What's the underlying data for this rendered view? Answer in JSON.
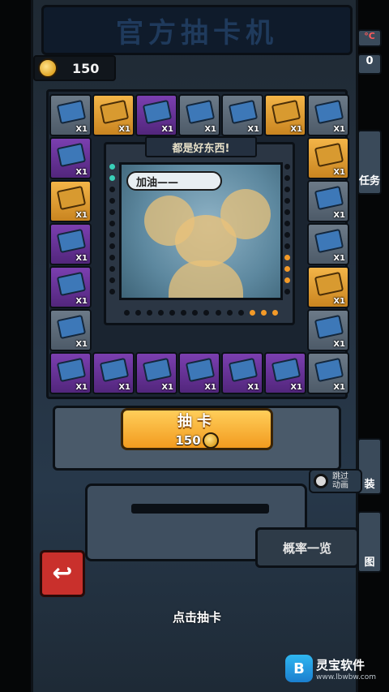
{
  "machine": {
    "title": "官方抽卡机",
    "coins": "150"
  },
  "board": {
    "top_row": [
      {
        "color": "gray",
        "qty": "X1"
      },
      {
        "color": "gold",
        "qty": "X1"
      },
      {
        "color": "purple",
        "qty": "X1"
      },
      {
        "color": "gray",
        "qty": "X1"
      },
      {
        "color": "gray",
        "qty": "X1"
      },
      {
        "color": "gold",
        "qty": "X1"
      },
      {
        "color": "gray",
        "qty": "X1"
      }
    ],
    "left_col": [
      {
        "color": "purple",
        "qty": "X1"
      },
      {
        "color": "gold",
        "qty": "X1"
      },
      {
        "color": "purple",
        "qty": "X1"
      },
      {
        "color": "purple",
        "qty": "X1"
      },
      {
        "color": "gray",
        "qty": "X1"
      }
    ],
    "right_col": [
      {
        "color": "gold",
        "qty": "X1"
      },
      {
        "color": "gray",
        "qty": "X1"
      },
      {
        "color": "gray",
        "qty": "X1"
      },
      {
        "color": "gold",
        "qty": "X1"
      },
      {
        "color": "gray",
        "qty": "X1"
      }
    ],
    "bottom_row": [
      {
        "color": "purple",
        "qty": "X1"
      },
      {
        "color": "purple",
        "qty": "X1"
      },
      {
        "color": "purple",
        "qty": "X1"
      },
      {
        "color": "purple",
        "qty": "X1"
      },
      {
        "color": "purple",
        "qty": "X1"
      },
      {
        "color": "purple",
        "qty": "X1"
      },
      {
        "color": "gray",
        "qty": "X1"
      }
    ]
  },
  "center": {
    "banner": "都是好东西!",
    "speech": "加油——"
  },
  "draw_button": {
    "label": "抽卡",
    "cost": "150"
  },
  "skip_toggle": {
    "label": "跳过动画"
  },
  "probability_button": {
    "label": "概率一览"
  },
  "footer": {
    "hint": "点击抽卡"
  },
  "side_peek": {
    "top_temp": "°C",
    "top_counter": "0",
    "task": "任务",
    "bag": "装",
    "map": "图"
  },
  "watermark": {
    "name": "灵宝软件",
    "url": "www.lbwbw.com",
    "logo_letter": "B"
  },
  "colors": {
    "gold_button": "#f29b1f",
    "back_button": "#c9302c",
    "teal_light": "#39d0b8",
    "orange_light": "#f39a28"
  }
}
